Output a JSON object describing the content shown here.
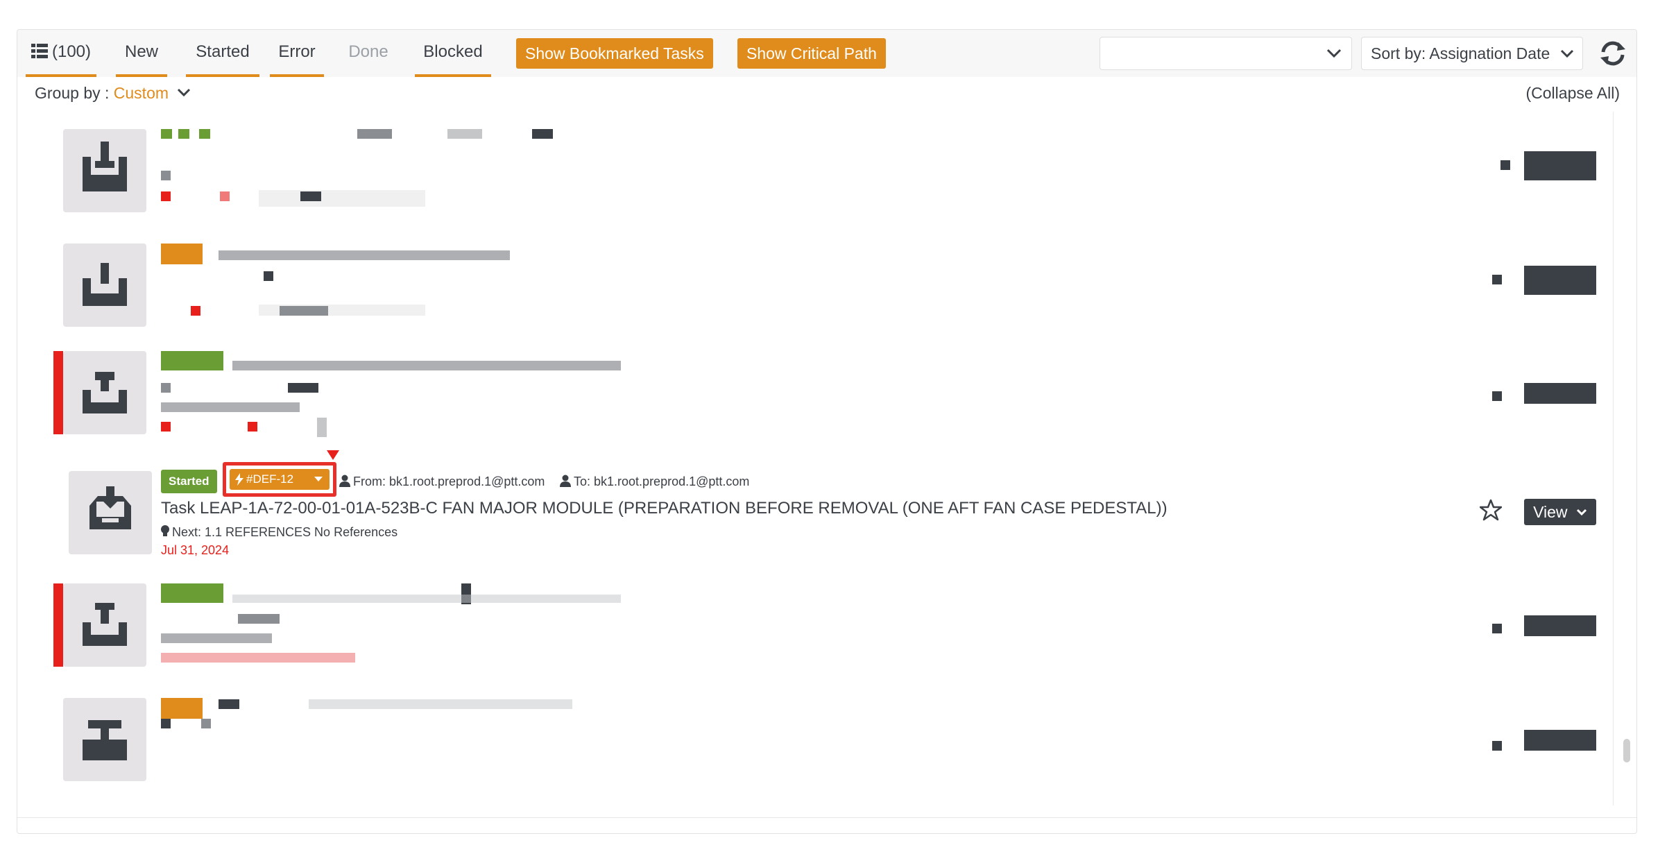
{
  "toolbar": {
    "count_label": "(100)",
    "tabs": [
      "New",
      "Started",
      "Error",
      "Done",
      "Blocked"
    ],
    "show_bookmarked_label": "Show Bookmarked Tasks",
    "show_critical_path_label": "Show Critical Path",
    "filter_value": "",
    "sort_label": "Sort by: Assignation Date"
  },
  "groupbar": {
    "group_by_label": "Group by : ",
    "group_by_value": "Custom",
    "collapse_all_label": "(Collapse All)"
  },
  "task": {
    "status": "Started",
    "reference": "#DEF-12",
    "from": "From: bk1.root.preprod.1@ptt.com",
    "to": "To: bk1.root.preprod.1@ptt.com",
    "title": "Task LEAP-1A-72-00-01-01A-523B-C FAN MAJOR MODULE (PREPARATION BEFORE REMOVAL (ONE AFT FAN CASE PEDESTAL))",
    "next": "Next: 1.1 REFERENCES No References",
    "due_date": "Jul 31, 2024",
    "view_label": "View"
  },
  "colors": {
    "accent": "#e08c1c",
    "started_green": "#6a9e35",
    "overdue_red": "#e8201c",
    "dark": "#3b3f46"
  },
  "icons": [
    "list-icon",
    "chevron-down-icon",
    "refresh-icon",
    "inbox-download-icon",
    "inbox-upload-icon",
    "bolt-icon",
    "user-icon",
    "lightbulb-icon",
    "star-icon"
  ]
}
